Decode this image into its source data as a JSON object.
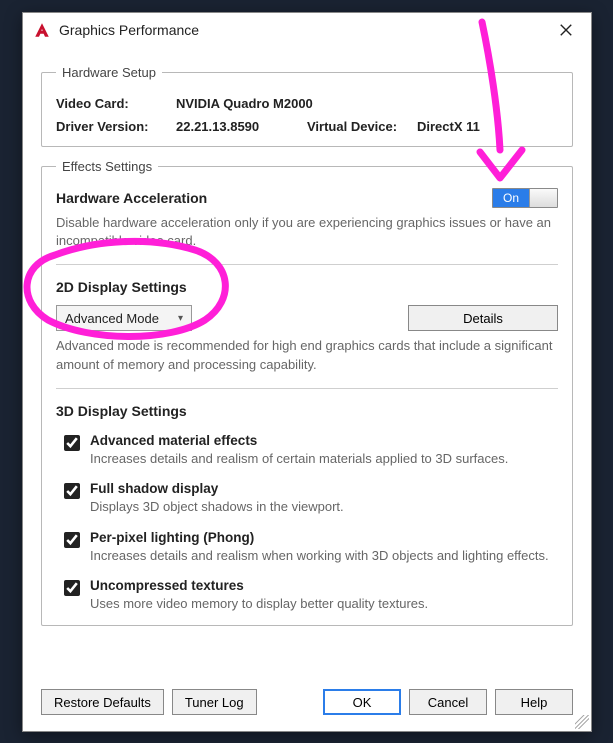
{
  "window": {
    "title": "Graphics Performance"
  },
  "hardware": {
    "legend": "Hardware Setup",
    "video_card_label": "Video Card:",
    "video_card": "NVIDIA Quadro M2000",
    "driver_label": "Driver Version:",
    "driver": "22.21.13.8590",
    "virtual_device_label": "Virtual Device:",
    "virtual_device": "DirectX 11"
  },
  "effects": {
    "legend": "Effects Settings",
    "accel_title": "Hardware Acceleration",
    "accel_state": "On",
    "accel_desc": "Disable hardware acceleration only if you are experiencing graphics issues or have an incompatible video card.",
    "d2_title": "2D Display Settings",
    "d2_mode": "Advanced Mode",
    "details_label": "Details",
    "d2_desc": "Advanced mode is recommended for high end graphics cards that include a significant amount of memory and processing capability.",
    "d3_title": "3D Display Settings",
    "d3_items": [
      {
        "title": "Advanced material effects",
        "desc": "Increases details and realism of certain materials applied to 3D surfaces."
      },
      {
        "title": "Full shadow display",
        "desc": "Displays 3D object shadows in the viewport."
      },
      {
        "title": "Per-pixel lighting (Phong)",
        "desc": "Increases details and realism when working with 3D objects and lighting effects."
      },
      {
        "title": "Uncompressed textures",
        "desc": "Uses more video memory to display better quality textures."
      }
    ]
  },
  "footer": {
    "restore": "Restore Defaults",
    "tuner": "Tuner Log",
    "ok": "OK",
    "cancel": "Cancel",
    "help": "Help"
  }
}
